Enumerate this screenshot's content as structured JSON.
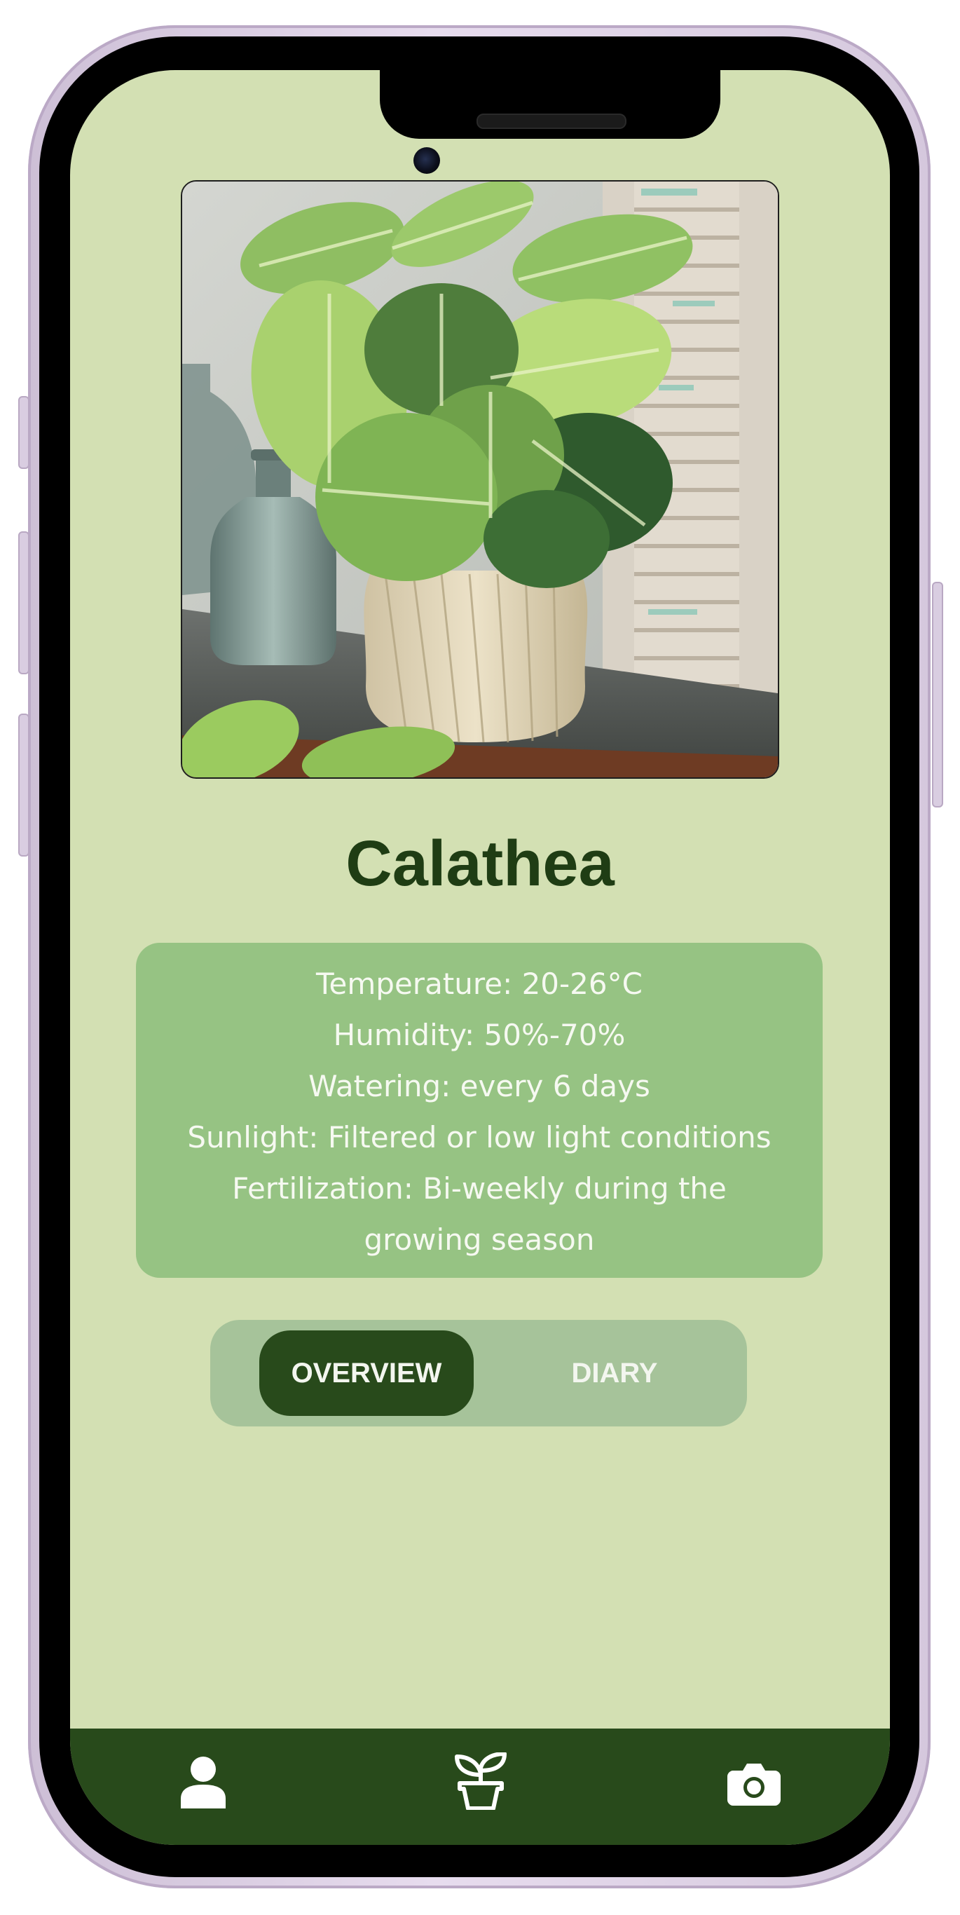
{
  "plant": {
    "name": "Calathea",
    "image_alt": "Calathea plant in a cream ceramic pot beside glass bottles"
  },
  "care": {
    "lines": [
      "Temperature: 20-26°C",
      "Humidity: 50%-70%",
      "Watering: every 6 days",
      "Sunlight: Filtered or low light conditions",
      "Fertilization: Bi-weekly during the",
      "growing season"
    ]
  },
  "tabs": {
    "items": [
      {
        "label": "OVERVIEW",
        "active": true
      },
      {
        "label": "DIARY",
        "active": false
      }
    ]
  },
  "bottom_nav": {
    "items": [
      {
        "icon": "person-icon"
      },
      {
        "icon": "plant-icon"
      },
      {
        "icon": "camera-icon"
      }
    ]
  },
  "colors": {
    "background": "#d3e0b3",
    "card": "#96c383",
    "dark_green": "#284a1b",
    "title": "#1f3d14",
    "tab_track": "#a6c39a"
  }
}
